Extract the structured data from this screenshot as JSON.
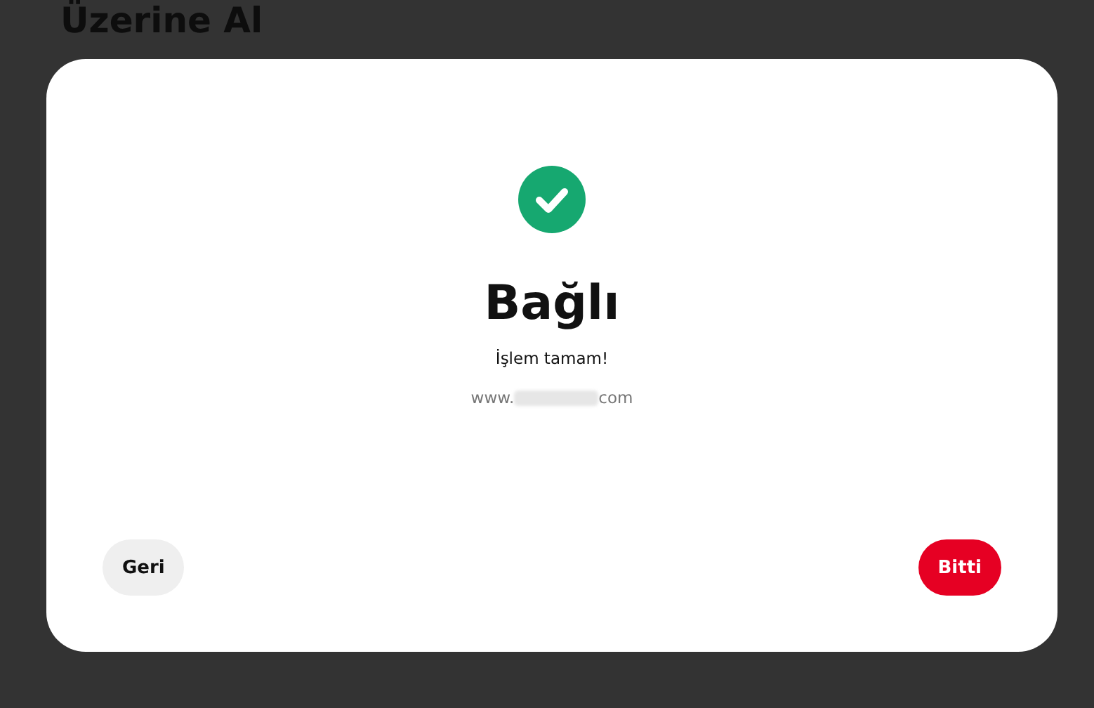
{
  "background_page": {
    "heading": "Üzerine Al"
  },
  "dialog": {
    "title": "Bağlı",
    "message": "İşlem tamam!",
    "url_start": "www.",
    "url_redacted": true,
    "url_end": "com",
    "buttons": [
      {
        "label": "Geri",
        "kind": "secondary"
      },
      {
        "label": "Bitti",
        "kind": "primary"
      }
    ]
  }
}
